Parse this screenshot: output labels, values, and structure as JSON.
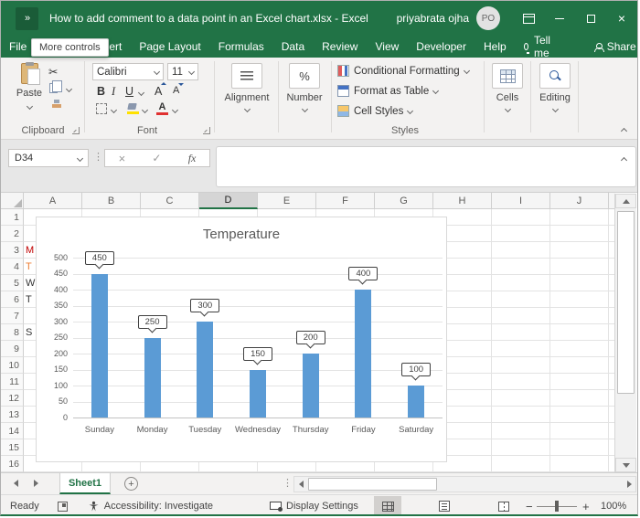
{
  "window": {
    "qat_overflow": "»",
    "title": "How to add comment to a data point in an Excel chart.xlsx  -  Excel",
    "user": "priyabrata ojha",
    "avatar_initials": "PO",
    "close_glyph": "×",
    "accent_color": "#217346"
  },
  "menubar": {
    "tabs": [
      "File",
      "Insert",
      "Page Layout",
      "Formulas",
      "Data",
      "Review",
      "View",
      "Developer",
      "Help"
    ],
    "tell_me_label": "Tell me",
    "share_label": "Share",
    "tooltip": "More controls"
  },
  "ribbon": {
    "paste_label": "Paste",
    "clipboard_label": "Clipboard",
    "font_name": "Calibri",
    "font_size": "11",
    "bold": "B",
    "italic": "I",
    "underline": "U",
    "grow_font": "A",
    "shrink_font": "A",
    "font_color_letter": "A",
    "font_label": "Font",
    "alignment_label": "Alignment",
    "number_label": "Number",
    "percent": "%",
    "styles_items": [
      "Conditional Formatting",
      "Format as Table",
      "Cell Styles"
    ],
    "styles_label": "Styles",
    "cells_label": "Cells",
    "editing_label": "Editing"
  },
  "formula_bar": {
    "name_box": "D34",
    "cancel_glyph": "×",
    "enter_glyph": "✓",
    "fx_label": "fx",
    "value": ""
  },
  "grid": {
    "columns": [
      "A",
      "B",
      "C",
      "D",
      "E",
      "F",
      "G",
      "H",
      "I",
      "J"
    ],
    "selected_column": "D",
    "rows": [
      "1",
      "2",
      "3",
      "4",
      "5",
      "6",
      "7",
      "8",
      "9",
      "10",
      "11",
      "12",
      "13",
      "14",
      "15",
      "16"
    ],
    "peek_cells": [
      {
        "row": 3,
        "text": "M",
        "color": "#c00000"
      },
      {
        "row": 4,
        "text": "T",
        "color": "#ed7d31"
      },
      {
        "row": 5,
        "text": "W",
        "color": "#333333"
      },
      {
        "row": 6,
        "text": "T",
        "color": "#333333"
      },
      {
        "row": 8,
        "text": "S",
        "color": "#333333"
      }
    ]
  },
  "chart_data": {
    "type": "bar",
    "title": "Temperature",
    "categories": [
      "Sunday",
      "Monday",
      "Tuesday",
      "Wednesday",
      "Thursday",
      "Friday",
      "Saturday"
    ],
    "values": [
      450,
      250,
      300,
      150,
      200,
      400,
      100
    ],
    "data_labels": [
      450,
      250,
      300,
      150,
      200,
      400,
      100
    ],
    "ylim": [
      0,
      500
    ],
    "ytick_step": 50,
    "bar_color": "#5b9bd5",
    "grid": true,
    "legend": false
  },
  "tabbar": {
    "sheet_name": "Sheet1",
    "add_sheet_glyph": "+"
  },
  "statusbar": {
    "ready": "Ready",
    "accessibility": "Accessibility: Investigate",
    "display_settings": "Display Settings",
    "zoom_minus": "−",
    "zoom_plus": "+",
    "zoom_level": "100%"
  }
}
